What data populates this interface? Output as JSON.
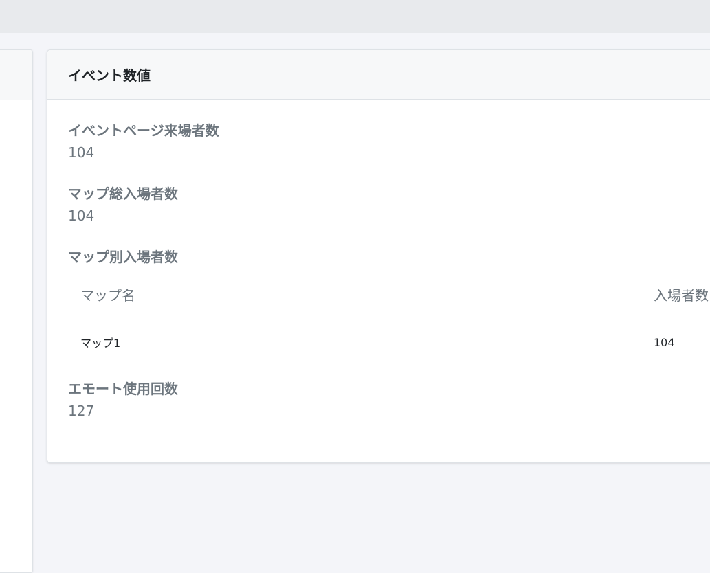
{
  "card": {
    "title": "イベント数値"
  },
  "stats": {
    "event_page_visitors": {
      "label": "イベントページ来場者数",
      "value": "104"
    },
    "map_total_entries": {
      "label": "マップ総入場者数",
      "value": "104"
    },
    "map_entries_by_map": {
      "label": "マップ別入場者数",
      "columns": [
        "マップ名",
        "入場者数"
      ],
      "rows": [
        {
          "map_name": "マップ1",
          "count": "104"
        }
      ]
    },
    "emote_uses": {
      "label": "エモート使用回数",
      "value": "127"
    }
  }
}
